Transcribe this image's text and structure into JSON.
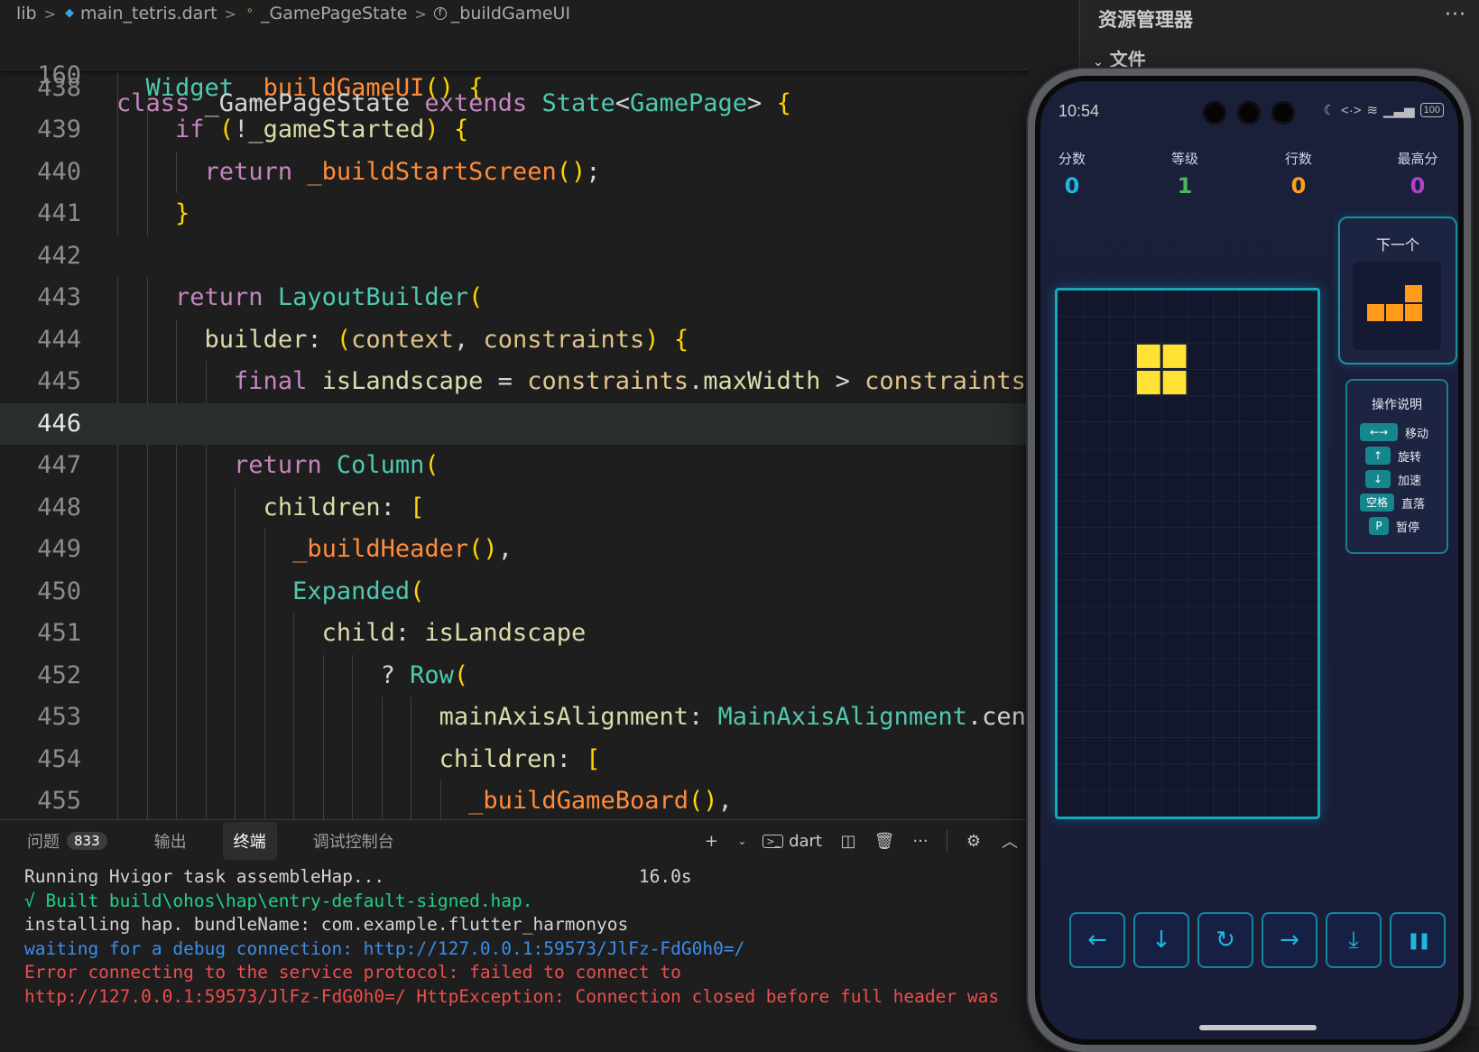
{
  "breadcrumb": {
    "items": [
      {
        "label": "lib",
        "icon": ""
      },
      {
        "label": "main_tetris.dart",
        "icon": "dart-file-icon"
      },
      {
        "label": "_GamePageState",
        "icon": "class-icon"
      },
      {
        "label": "_buildGameUI",
        "icon": "function-icon"
      }
    ]
  },
  "editor": {
    "sticky_line": {
      "number": "160",
      "code": "class _GamePageState extends State<GamePage> {"
    },
    "active_line": "446",
    "lines": [
      {
        "number": "438",
        "code": "  Widget _buildGameUI() {"
      },
      {
        "number": "439",
        "code": "    if (!_gameStarted) {"
      },
      {
        "number": "440",
        "code": "      return _buildStartScreen();"
      },
      {
        "number": "441",
        "code": "    }"
      },
      {
        "number": "442",
        "code": ""
      },
      {
        "number": "443",
        "code": "    return LayoutBuilder("
      },
      {
        "number": "444",
        "code": "      builder: (context, constraints) {"
      },
      {
        "number": "445",
        "code": "        final isLandscape = constraints.maxWidth > constraints"
      },
      {
        "number": "446",
        "code": ""
      },
      {
        "number": "447",
        "code": "        return Column("
      },
      {
        "number": "448",
        "code": "          children: ["
      },
      {
        "number": "449",
        "code": "            _buildHeader(),"
      },
      {
        "number": "450",
        "code": "            Expanded("
      },
      {
        "number": "451",
        "code": "              child: isLandscape"
      },
      {
        "number": "452",
        "code": "                  ? Row("
      },
      {
        "number": "453",
        "code": "                      mainAxisAlignment: MainAxisAlignment.cent"
      },
      {
        "number": "454",
        "code": "                      children: ["
      },
      {
        "number": "455",
        "code": "                        _buildGameBoard(),"
      }
    ]
  },
  "explorer": {
    "title": "资源管理器",
    "more": "···",
    "files_section": "文件"
  },
  "panel": {
    "tabs": [
      {
        "label": "问题",
        "badge": "833",
        "active": false
      },
      {
        "label": "输出",
        "badge": "",
        "active": false
      },
      {
        "label": "终端",
        "badge": "",
        "active": true
      },
      {
        "label": "调试控制台",
        "badge": "",
        "active": false
      }
    ],
    "terminal_name": "dart",
    "terminal_lines": [
      {
        "text": "Running Hvigor task assembleHap...                        16.0s",
        "color": "white"
      },
      {
        "text": "√ Built build\\ohos\\hap\\entry-default-signed.hap.",
        "color": "green"
      },
      {
        "text": "installing hap. bundleName: com.example.flutter_harmonyos",
        "color": "white"
      },
      {
        "text": "waiting for a debug connection: http://127.0.0.1:59573/JlFz-FdG0h0=/",
        "color": "blue"
      },
      {
        "text": "Error connecting to the service protocol: failed to connect to",
        "color": "red"
      },
      {
        "text": "http://127.0.0.1:59573/JlFz-FdG0h0=/ HttpException: Connection closed before full header was",
        "color": "red"
      }
    ]
  },
  "phone": {
    "status": {
      "time": "10:54",
      "battery": "100"
    },
    "stats": [
      {
        "label": "分数",
        "value": "0",
        "color": "#1fb6e0"
      },
      {
        "label": "等级",
        "value": "1",
        "color": "#46b85a"
      },
      {
        "label": "行数",
        "value": "0",
        "color": "#ff9f1c"
      },
      {
        "label": "最高分",
        "value": "0",
        "color": "#b043c9"
      }
    ],
    "next_title": "下一个",
    "next_piece": {
      "shape": "L",
      "color": "#ff9a1a",
      "cells": [
        [
          2,
          0
        ],
        [
          0,
          1
        ],
        [
          1,
          1
        ],
        [
          2,
          1
        ]
      ]
    },
    "help": {
      "title": "操作说明",
      "rows": [
        {
          "key": "←→",
          "action": "移动"
        },
        {
          "key": "↑",
          "action": "旋转"
        },
        {
          "key": "↓",
          "action": "加速"
        },
        {
          "key": "空格",
          "action": "直落"
        },
        {
          "key": "P",
          "action": "暂停"
        }
      ]
    },
    "board": {
      "cols": 10,
      "rows": 20,
      "active_piece": {
        "shape": "O",
        "color": "#ffe234",
        "cells": [
          [
            3,
            2
          ],
          [
            4,
            2
          ],
          [
            3,
            3
          ],
          [
            4,
            3
          ]
        ]
      }
    },
    "controls": [
      {
        "name": "left",
        "glyph": "←"
      },
      {
        "name": "down",
        "glyph": "↓"
      },
      {
        "name": "rotate",
        "glyph": "↻"
      },
      {
        "name": "right",
        "glyph": "→"
      },
      {
        "name": "drop",
        "glyph": "⤓"
      },
      {
        "name": "pause",
        "glyph": "❚❚"
      }
    ]
  }
}
